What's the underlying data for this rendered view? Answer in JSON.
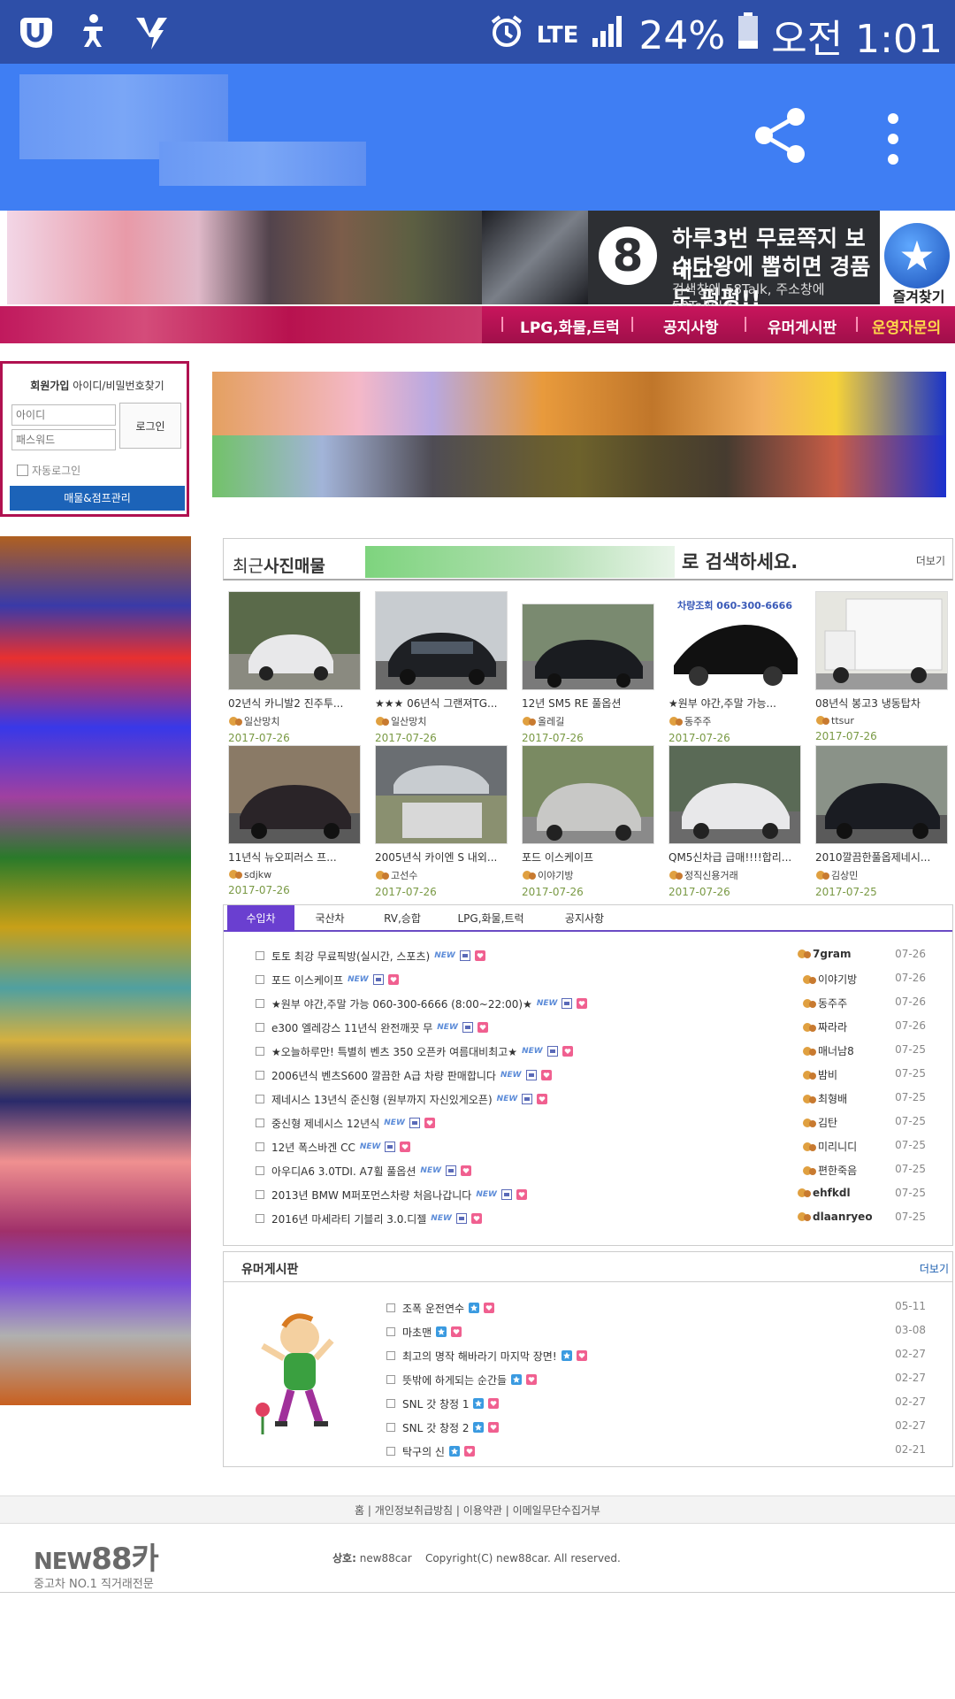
{
  "status_bar": {
    "network": "LTE",
    "battery": "24%",
    "time": "오전 1:01"
  },
  "banner": {
    "ad_line1": "하루3번 무료쪽지 보내고",
    "ad_line2": "수다왕에 뽑히면 경품도 펑펑!!",
    "ad_line3": "검색창에 58Talk, 주소창에 58Talk.kr",
    "ad_badge": "8",
    "favorite_label": "즐겨찾기"
  },
  "menu": {
    "items": [
      "LPG,화물,트럭",
      "공지사항",
      "유머게시판",
      "운영자문의"
    ]
  },
  "login": {
    "signup": "회원가입",
    "find": "아이디/비밀번호찾기",
    "id_placeholder": "아이디",
    "pw_placeholder": "패스워드",
    "login_button": "로그인",
    "auto_login": "자동로그인",
    "manage_button": "매물&점프관리"
  },
  "photo_section": {
    "title_prefix": "최근",
    "title_bold": "사진매물",
    "search_text": "로 검색하세요.",
    "more": "더보기",
    "items": [
      {
        "caption": "02년식 카니발2 진주투...",
        "user": "일산망치",
        "date": "2017-07-26"
      },
      {
        "caption": "★★★ 06년식 그랜져TG...",
        "user": "일산망치",
        "date": "2017-07-26"
      },
      {
        "caption": "12년 SM5 RE 풀옵션",
        "user": "올레길",
        "date": "2017-07-26"
      },
      {
        "caption": "★원부 야간,주말 가능...",
        "user": "동주주",
        "date": "2017-07-26"
      },
      {
        "caption": "08년식 봉고3 냉동탑차",
        "user": "ttsur",
        "date": "2017-07-26"
      },
      {
        "caption": "11년식 뉴오피러스 프...",
        "user": "sdjkw",
        "date": "2017-07-26"
      },
      {
        "caption": "2005년식 카이엔 S 내외...",
        "user": "고선수",
        "date": "2017-07-26"
      },
      {
        "caption": "포드 이스케이프",
        "user": "이야기방",
        "date": "2017-07-26"
      },
      {
        "caption": "QM5신차급 급매!!!!합리...",
        "user": "정직신용거래",
        "date": "2017-07-26"
      },
      {
        "caption": "2010깔끔한풀옵제네시...",
        "user": "김상민",
        "date": "2017-07-25"
      }
    ],
    "thumb4_text": "차량조회 060-300-6666"
  },
  "tabs": {
    "items": [
      "수입차",
      "국산차",
      "RV,승합",
      "LPG,화물,트럭",
      "공지사항"
    ],
    "active": 0,
    "new_label": "NEW",
    "rows": [
      {
        "title": "토토 최강 무료픽방(실시간, 스포츠)",
        "user": "7gram",
        "date": "07-26",
        "bold_user": true
      },
      {
        "title": "포드 이스케이프",
        "user": "이야기방",
        "date": "07-26",
        "bold_user": false
      },
      {
        "title": "★원부 야간,주말 가능 060-300-6666 (8:00~22:00)★",
        "user": "동주주",
        "date": "07-26",
        "bold_user": false
      },
      {
        "title": "e300 엘레강스 11년식 완전깨끗 무",
        "user": "짜라라",
        "date": "07-26",
        "bold_user": false
      },
      {
        "title": "★오늘하루만! 특별히 벤츠 350 오픈카 여름대비최고★",
        "user": "매너남8",
        "date": "07-25",
        "bold_user": false
      },
      {
        "title": "2006년식 벤츠S600 깔끔한 A급 차량 판매합니다",
        "user": "밤비",
        "date": "07-25",
        "bold_user": false
      },
      {
        "title": "제네시스 13년식 준신형 (원부까지 자신있게오픈)",
        "user": "최형배",
        "date": "07-25",
        "bold_user": false
      },
      {
        "title": "중신형 제네시스 12년식",
        "user": "김탄",
        "date": "07-25",
        "bold_user": false
      },
      {
        "title": "12년 폭스바겐 CC",
        "user": "미리니디",
        "date": "07-25",
        "bold_user": false
      },
      {
        "title": "아우디A6 3.0TDI. A7휠 풀옵션",
        "user": "편한죽음",
        "date": "07-25",
        "bold_user": false
      },
      {
        "title": "2013년 BMW M퍼포먼스차량 처음나갑니다",
        "user": "ehfkdl",
        "date": "07-25",
        "bold_user": true
      },
      {
        "title": "2016년 마세라티 기블리 3.0.디젤",
        "user": "dlaanryeo",
        "date": "07-25",
        "bold_user": true
      }
    ]
  },
  "humor": {
    "title": "유머게시판",
    "more": "더보기",
    "rows": [
      {
        "title": "조폭 운전연수",
        "date": "05-11"
      },
      {
        "title": "마초맨",
        "date": "03-08"
      },
      {
        "title": "최고의 명작 해바라기 마지막 장면!",
        "date": "02-27"
      },
      {
        "title": "뜻밖에 하게되는 순간들",
        "date": "02-27"
      },
      {
        "title": "SNL 갓 창정 1",
        "date": "02-27"
      },
      {
        "title": "SNL 갓 창정 2",
        "date": "02-27"
      },
      {
        "title": "탁구의 신",
        "date": "02-21"
      }
    ]
  },
  "footer": {
    "links": "홈 | 개인정보취급방침 | 이용약관 | 이메일무단수집거부",
    "logo_new": "NEW",
    "logo_num": "88카",
    "logo_sub": "중고차 NO.1 직거래전문",
    "company_label": "상호:",
    "company": "new88car",
    "copyright": "Copyright(C) new88car. All reserved."
  },
  "colors": {
    "status_bar": "#2e4fa8",
    "app_bar": "#3f7ef3",
    "menu_bar": "#b8124f",
    "tab_active": "#6a3fd0",
    "date_green": "#7a9a45"
  }
}
